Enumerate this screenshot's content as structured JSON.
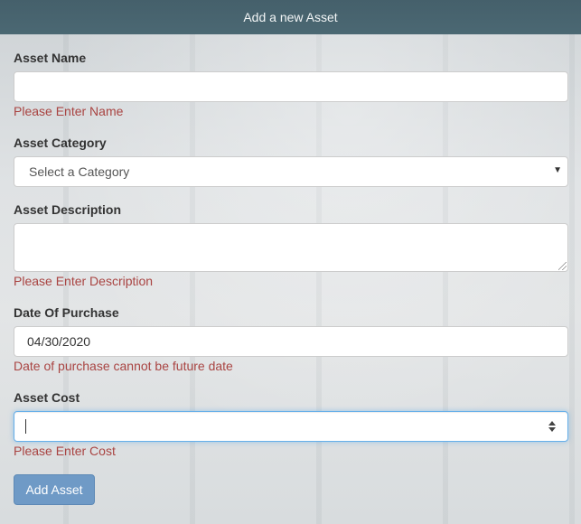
{
  "header": {
    "title": "Add a new Asset"
  },
  "fields": {
    "name": {
      "label": "Asset Name",
      "value": "",
      "error": "Please Enter Name"
    },
    "category": {
      "label": "Asset Category",
      "selected": "Select a Category"
    },
    "description": {
      "label": "Asset Description",
      "value": "",
      "error": "Please Enter Description"
    },
    "date": {
      "label": "Date Of Purchase",
      "value": "04/30/2020",
      "error": "Date of purchase cannot be future date"
    },
    "cost": {
      "label": "Asset Cost",
      "value": "",
      "error": "Please Enter Cost"
    }
  },
  "actions": {
    "submit_label": "Add Asset"
  },
  "colors": {
    "header": "#4b6873",
    "error": "#a94442",
    "button": "#6f9ac6",
    "focus": "#66afe9"
  },
  "icons": {
    "select": "chevron-down-icon",
    "stepper": "spinner-icon",
    "resize": "resize-grip-icon"
  }
}
